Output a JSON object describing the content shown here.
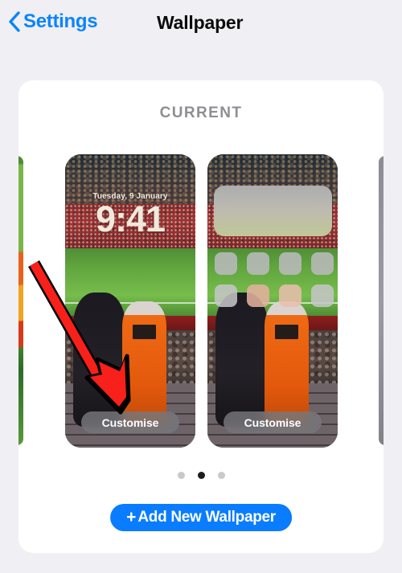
{
  "navbar": {
    "back_label": "Settings",
    "back_icon": "chevron-left-icon",
    "title": "Wallpaper"
  },
  "card": {
    "section_title": "CURRENT"
  },
  "carousel": {
    "previews": [
      {
        "kind": "lock-screen",
        "date": "Tuesday, 9 January",
        "time": "9:41",
        "customise_label": "Customise"
      },
      {
        "kind": "home-screen",
        "customise_label": "Customise"
      }
    ],
    "edge_previews": [
      {
        "side": "left",
        "description": "green-orange-wallpaper-sliver"
      },
      {
        "side": "right",
        "description": "gray-wallpaper-sliver"
      }
    ],
    "page_dots": {
      "count": 3,
      "active_index": 1
    }
  },
  "add_button": {
    "plus": "+",
    "label": "Add New Wallpaper"
  },
  "annotation": {
    "type": "arrow",
    "color": "#f8201a",
    "outline_color": "#000000",
    "points_to": "customise-button-lock-screen"
  },
  "colors": {
    "page_background": "#f0eff4",
    "card_background": "#ffffff",
    "accent_blue": "#0a7cff",
    "link_blue": "#0a84ff",
    "section_title_gray": "#8e8e93",
    "dot_inactive": "#c9c9cd",
    "dot_active": "#1c1c1e",
    "annotation_red": "#f8201a"
  }
}
